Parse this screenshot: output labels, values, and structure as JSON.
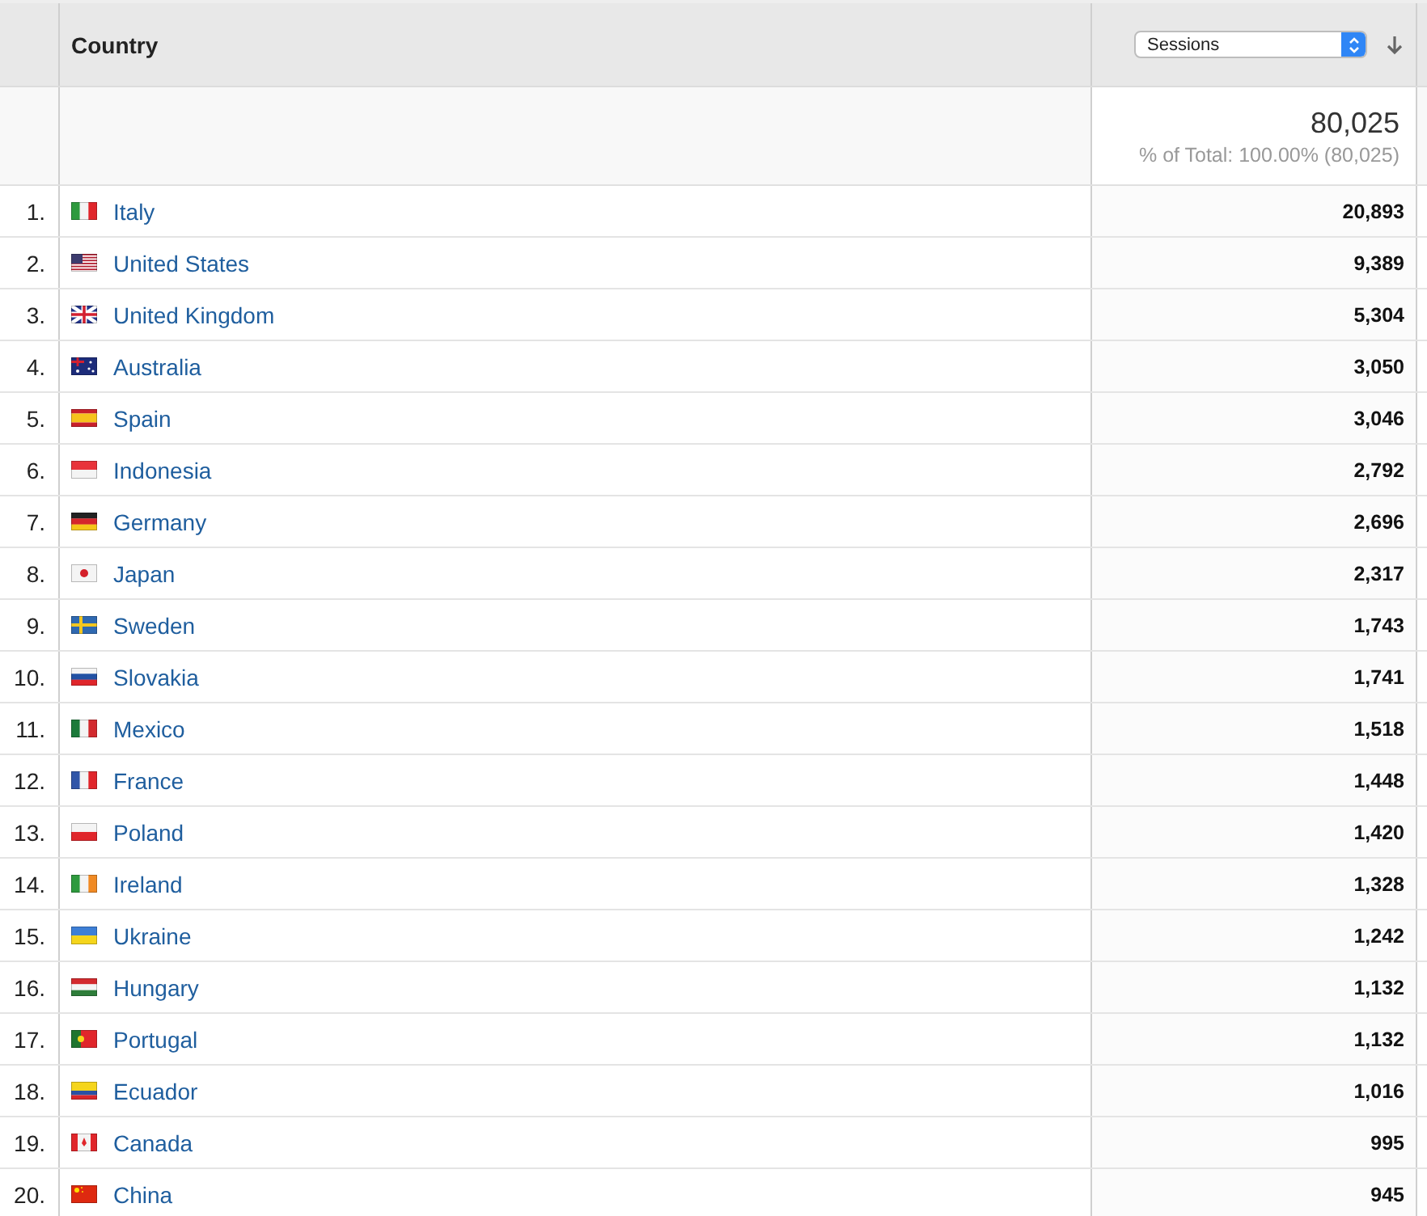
{
  "table": {
    "columns": {
      "country": "Country",
      "metric_select": "Sessions"
    },
    "total": {
      "value": "80,025",
      "share": "% of Total: 100.00% (80,025)"
    },
    "rows": [
      {
        "rank": "1.",
        "country": "Italy",
        "sessions": "20,893"
      },
      {
        "rank": "2.",
        "country": "United States",
        "sessions": "9,389"
      },
      {
        "rank": "3.",
        "country": "United Kingdom",
        "sessions": "5,304"
      },
      {
        "rank": "4.",
        "country": "Australia",
        "sessions": "3,050"
      },
      {
        "rank": "5.",
        "country": "Spain",
        "sessions": "3,046"
      },
      {
        "rank": "6.",
        "country": "Indonesia",
        "sessions": "2,792"
      },
      {
        "rank": "7.",
        "country": "Germany",
        "sessions": "2,696"
      },
      {
        "rank": "8.",
        "country": "Japan",
        "sessions": "2,317"
      },
      {
        "rank": "9.",
        "country": "Sweden",
        "sessions": "1,743"
      },
      {
        "rank": "10.",
        "country": "Slovakia",
        "sessions": "1,741"
      },
      {
        "rank": "11.",
        "country": "Mexico",
        "sessions": "1,518"
      },
      {
        "rank": "12.",
        "country": "France",
        "sessions": "1,448"
      },
      {
        "rank": "13.",
        "country": "Poland",
        "sessions": "1,420"
      },
      {
        "rank": "14.",
        "country": "Ireland",
        "sessions": "1,328"
      },
      {
        "rank": "15.",
        "country": "Ukraine",
        "sessions": "1,242"
      },
      {
        "rank": "16.",
        "country": "Hungary",
        "sessions": "1,132"
      },
      {
        "rank": "17.",
        "country": "Portugal",
        "sessions": "1,132"
      },
      {
        "rank": "18.",
        "country": "Ecuador",
        "sessions": "1,016"
      },
      {
        "rank": "19.",
        "country": "Canada",
        "sessions": "995"
      },
      {
        "rank": "20.",
        "country": "China",
        "sessions": "945"
      }
    ]
  }
}
